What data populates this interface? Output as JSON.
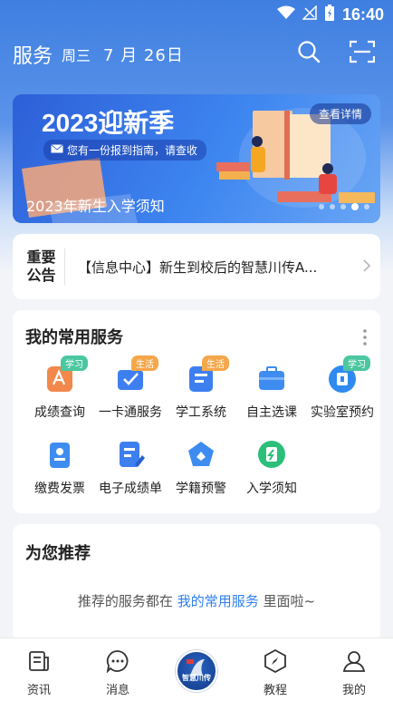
{
  "status_bar": {
    "time": "16:40"
  },
  "header": {
    "title": "服务",
    "weekday": "周三",
    "date": "7 月 26日"
  },
  "banner": {
    "title": "2023迎新季",
    "subtitle": "您有一份报到指南，请查收",
    "detail_label": "查看详情",
    "caption": "2023年新生入学须知",
    "slide_count": 5,
    "active_slide": 4
  },
  "notice": {
    "label_line1": "重要",
    "label_line2": "公告",
    "text": "【信息中心】新生到校后的智慧川传A..."
  },
  "services": {
    "title": "我的常用服务",
    "items": [
      {
        "label": "成绩查询",
        "tag": "学习",
        "icon": "grade-query-icon"
      },
      {
        "label": "一卡通服务",
        "tag": "生活",
        "icon": "campus-card-icon"
      },
      {
        "label": "学工系统",
        "tag": "生活",
        "icon": "student-affairs-icon"
      },
      {
        "label": "自主选课",
        "tag": "",
        "icon": "course-selection-icon"
      },
      {
        "label": "实验室预约",
        "tag": "学习",
        "icon": "lab-booking-icon"
      },
      {
        "label": "缴费发票",
        "tag": "",
        "icon": "invoice-icon"
      },
      {
        "label": "电子成绩单",
        "tag": "",
        "icon": "transcript-icon"
      },
      {
        "label": "学籍预警",
        "tag": "",
        "icon": "status-warning-icon"
      },
      {
        "label": "入学须知",
        "tag": "",
        "icon": "admission-guide-icon"
      }
    ]
  },
  "recommend": {
    "title": "为您推荐",
    "text_before": "推荐的服务都在",
    "link": "我的常用服务",
    "text_after": "里面啦~"
  },
  "tabbar": {
    "items": [
      {
        "label": "资讯",
        "icon": "news-icon"
      },
      {
        "label": "消息",
        "icon": "message-icon"
      },
      {
        "label": "",
        "icon": "school-logo-icon"
      },
      {
        "label": "教程",
        "icon": "compass-icon"
      },
      {
        "label": "我的",
        "icon": "profile-icon"
      }
    ],
    "logo_text": "智慧川传"
  },
  "colors": {
    "primary": "#3f7fe0",
    "link": "#2f7ef0",
    "tag_green": "#4bc7a0",
    "tag_orange": "#f4a74b"
  }
}
